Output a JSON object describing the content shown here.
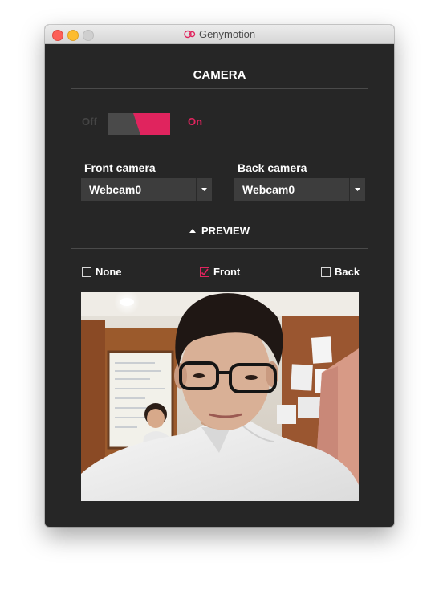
{
  "window": {
    "title": "Genymotion"
  },
  "camera": {
    "heading": "CAMERA"
  },
  "toggle": {
    "off_label": "Off",
    "on_label": "On",
    "state": "on",
    "accent": "#e0245e"
  },
  "front_camera": {
    "label": "Front camera",
    "value": "Webcam0"
  },
  "back_camera": {
    "label": "Back camera",
    "value": "Webcam0"
  },
  "preview": {
    "heading": "PREVIEW",
    "expanded": true,
    "options": [
      {
        "label": "None",
        "checked": false
      },
      {
        "label": "Front",
        "checked": true
      },
      {
        "label": "Back",
        "checked": false
      }
    ]
  },
  "icons": {
    "app": "genymotion-logo-icon",
    "preview_toggle": "triangle-up-icon",
    "dropdown": "caret-down-icon",
    "check": "checkmark-icon"
  }
}
